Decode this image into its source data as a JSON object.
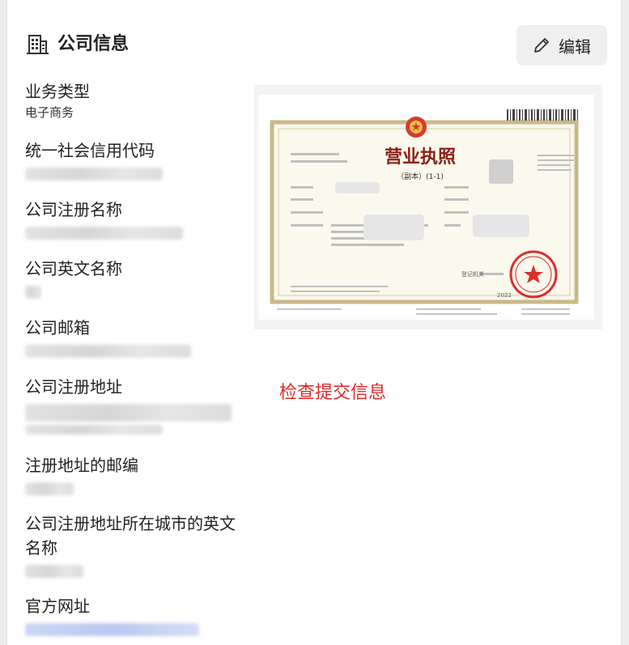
{
  "header": {
    "title": "公司信息",
    "icon": "building-icon"
  },
  "edit_button": {
    "label": "编辑",
    "icon": "pencil-icon"
  },
  "fields": [
    {
      "label": "业务类型",
      "value": "电子商务"
    },
    {
      "label": "统一社会信用代码",
      "value": ""
    },
    {
      "label": "公司注册名称",
      "value": ""
    },
    {
      "label": "公司英文名称",
      "value": ""
    },
    {
      "label": "公司邮箱",
      "value": ""
    },
    {
      "label": "公司注册地址",
      "value": ""
    },
    {
      "label": "注册地址的邮编",
      "value": ""
    },
    {
      "label": "公司注册地址所在城市的英文名称",
      "value": ""
    },
    {
      "label": "官方网址",
      "value": ""
    }
  ],
  "license": {
    "title": "营业执照",
    "subtitle": "（副本）(1-1)",
    "authority": "登记机关",
    "year": "2022",
    "seal_color": "#d9302b",
    "frame_color": "#c9b98a"
  },
  "review_note": "检查提交信息",
  "colors": {
    "accent_red": "#e02a2a",
    "button_bg": "#efefef"
  }
}
